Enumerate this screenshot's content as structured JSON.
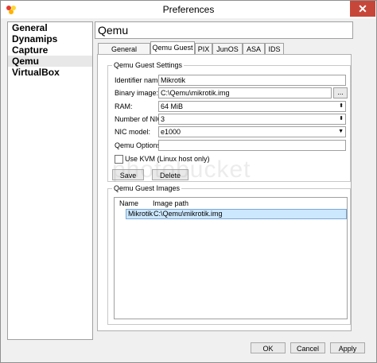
{
  "window": {
    "title": "Preferences",
    "close_icon": "close-icon"
  },
  "sidebar": {
    "items": [
      {
        "label": "General"
      },
      {
        "label": "Dynamips"
      },
      {
        "label": "Capture"
      },
      {
        "label": "Qemu",
        "selected": true
      },
      {
        "label": "VirtualBox"
      }
    ]
  },
  "panel": {
    "title": "Qemu"
  },
  "tabs": [
    {
      "label": "General Settings"
    },
    {
      "label": "Qemu Guest",
      "active": true
    },
    {
      "label": "PIX"
    },
    {
      "label": "JunOS"
    },
    {
      "label": "ASA"
    },
    {
      "label": "IDS"
    }
  ],
  "guest_settings": {
    "group_title": "Qemu Guest Settings",
    "identifier_label": "Identifier name:",
    "identifier_value": "Mikrotik",
    "binary_label": "Binary image:",
    "binary_value": "C:\\Qemu\\mikrotik.img",
    "browse_label": "...",
    "ram_label": "RAM:",
    "ram_value": "64 MiB",
    "nics_label": "Number of NICs:",
    "nics_value": "3",
    "nic_model_label": "NIC model:",
    "nic_model_value": "e1000",
    "options_label": "Qemu Options:",
    "options_value": "",
    "kvm_label": "Use KVM (Linux host only)",
    "save_label": "Save",
    "delete_label": "Delete"
  },
  "guest_images": {
    "group_title": "Qemu Guest Images",
    "columns": [
      "Name",
      "Image path"
    ],
    "rows": [
      {
        "name": "Mikrotik",
        "path": "C:\\Qemu\\mikrotik.img"
      }
    ]
  },
  "buttons": {
    "ok": "OK",
    "cancel": "Cancel",
    "apply": "Apply"
  },
  "watermark": "photobucket",
  "colors": {
    "close_red": "#c7463a",
    "selection_blue": "#cce8ff"
  }
}
